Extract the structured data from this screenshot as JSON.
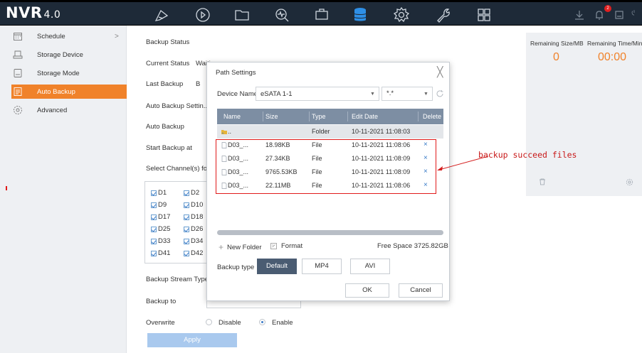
{
  "app": {
    "logo": "NVR",
    "version": "4.0",
    "notification_count": "2"
  },
  "toolbar_icons": [
    "preview-icon",
    "playback-icon",
    "file-icon",
    "smart-icon",
    "config-icon",
    "storage-icon",
    "settings-icon",
    "maintenance-icon",
    "layout-icon"
  ],
  "toolbar_right_icons": [
    "download-icon",
    "alarm-icon",
    "disk-icon"
  ],
  "sidebar": {
    "items": [
      {
        "label": "Schedule",
        "icon": "calendar-icon",
        "has_chevron": true
      },
      {
        "label": "Storage Device",
        "icon": "hdd-icon"
      },
      {
        "label": "Storage Mode",
        "icon": "mode-icon"
      },
      {
        "label": "Auto Backup",
        "icon": "backup-icon",
        "active": true
      },
      {
        "label": "Advanced",
        "icon": "gear-icon"
      }
    ],
    "chevron": ">"
  },
  "form": {
    "backup_status": "Backup Status",
    "current_status_label": "Current Status",
    "current_status_value": "Waiting",
    "last_backup_label": "Last Backup",
    "last_backup_value": "B",
    "auto_backup_settings": "Auto Backup Settin...",
    "auto_backup_label": "Auto Backup",
    "start_backup_label": "Start Backup at",
    "select_channels_label": "Select Channel(s) for E",
    "channels": [
      "D1",
      "D2",
      "D9",
      "D10",
      "D17",
      "D18",
      "D25",
      "D26",
      "D33",
      "D34",
      "D41",
      "D42"
    ],
    "backup_stream_type": "Backup Stream Type",
    "backup_to": "Backup to",
    "overwrite_label": "Overwrite",
    "disable": "Disable",
    "enable": "Enable",
    "apply": "Apply"
  },
  "right_panel": {
    "remaining_size_label": "Remaining Size/MB",
    "remaining_time_label": "Remaining Time/Min",
    "remaining_size": "0",
    "remaining_time": "00:00"
  },
  "dialog": {
    "title": "Path Settings",
    "close": "╳",
    "device_name_label": "Device Name",
    "device_name_value": "eSATA 1-1",
    "file_ext_value": "*.*",
    "columns": {
      "name": "Name",
      "size": "Size",
      "type": "Type",
      "edit_date": "Edit Date",
      "delete": "Delete"
    },
    "rows": [
      {
        "name": "..",
        "size": "",
        "type": "Folder",
        "date": "10-11-2021 11:08:03",
        "delete": ""
      },
      {
        "name": "D03_...",
        "size": "18.98KB",
        "type": "File",
        "date": "10-11-2021 11:08:06",
        "delete": "×"
      },
      {
        "name": "D03_...",
        "size": "27.34KB",
        "type": "File",
        "date": "10-11-2021 11:08:09",
        "delete": "×"
      },
      {
        "name": "D03_...",
        "size": "9765.53KB",
        "type": "File",
        "date": "10-11-2021 11:08:09",
        "delete": "×"
      },
      {
        "name": "D03_...",
        "size": "22.11MB",
        "type": "File",
        "date": "10-11-2021 11:08:06",
        "delete": "×"
      }
    ],
    "new_folder": "New Folder",
    "format": "Format",
    "free_space": "Free Space 3725.82GB",
    "backup_type_label": "Backup type",
    "backup_types": [
      "Default",
      "MP4",
      "AVI"
    ],
    "ok": "OK",
    "cancel": "Cancel"
  },
  "annotation": {
    "text": "backup succeed files",
    "color": "#c81818"
  },
  "colors": {
    "accent": "#f0822a",
    "header_bg": "#1e2a38",
    "table_header": "#7d8ea3",
    "link_blue": "#3a7bc8"
  }
}
